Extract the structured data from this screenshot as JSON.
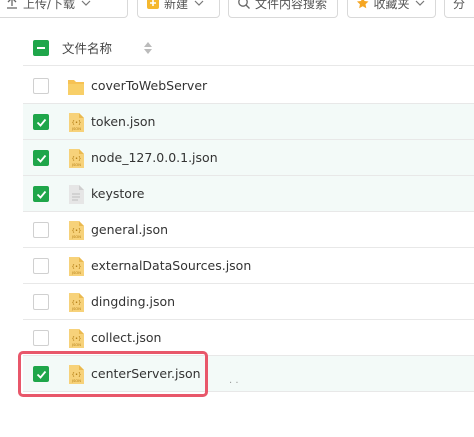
{
  "toolbar": {
    "upload_label": "上传/下载",
    "new_label": "新建",
    "search_label": "文件内容搜索",
    "fav_label": "收藏夹",
    "more_label": "分"
  },
  "list": {
    "header_label": "文件名称",
    "rows": [
      {
        "name": "coverToWebServer",
        "type": "folder",
        "checked": false
      },
      {
        "name": "token.json",
        "type": "json",
        "checked": true
      },
      {
        "name": "node_127.0.0.1.json",
        "type": "json",
        "checked": true
      },
      {
        "name": "keystore",
        "type": "file",
        "checked": true
      },
      {
        "name": "general.json",
        "type": "json",
        "checked": false
      },
      {
        "name": "externalDataSources.json",
        "type": "json",
        "checked": false
      },
      {
        "name": "dingding.json",
        "type": "json",
        "checked": false
      },
      {
        "name": "collect.json",
        "type": "json",
        "checked": false
      },
      {
        "name": "centerServer.json",
        "type": "json",
        "checked": true
      }
    ]
  },
  "colors": {
    "accent_green": "#1fa64a",
    "highlight_red": "#e8576a",
    "selected_row_bg": "#f3faf8"
  }
}
